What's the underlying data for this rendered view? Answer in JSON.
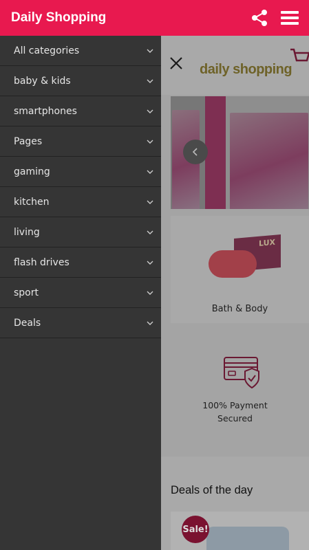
{
  "appbar": {
    "title": "Daily Shopping",
    "share_icon": "share-icon",
    "menu_icon": "hamburger-menu-icon",
    "color": "#e8194f"
  },
  "drawer": {
    "items": [
      {
        "label": "All categories"
      },
      {
        "label": "baby & kids"
      },
      {
        "label": "smartphones"
      },
      {
        "label": "Pages"
      },
      {
        "label": "gaming"
      },
      {
        "label": "kitchen"
      },
      {
        "label": "living"
      },
      {
        "label": "flash drives"
      },
      {
        "label": "sport"
      },
      {
        "label": "Deals"
      }
    ]
  },
  "page": {
    "logo_text": "daily shopping",
    "soap_brand": "LUX",
    "category_caption": "Bath & Body",
    "payment_line1": "100% Payment",
    "payment_line2": "Secured",
    "deals_title": "Deals of the day",
    "sale_badge": "Sale!"
  }
}
